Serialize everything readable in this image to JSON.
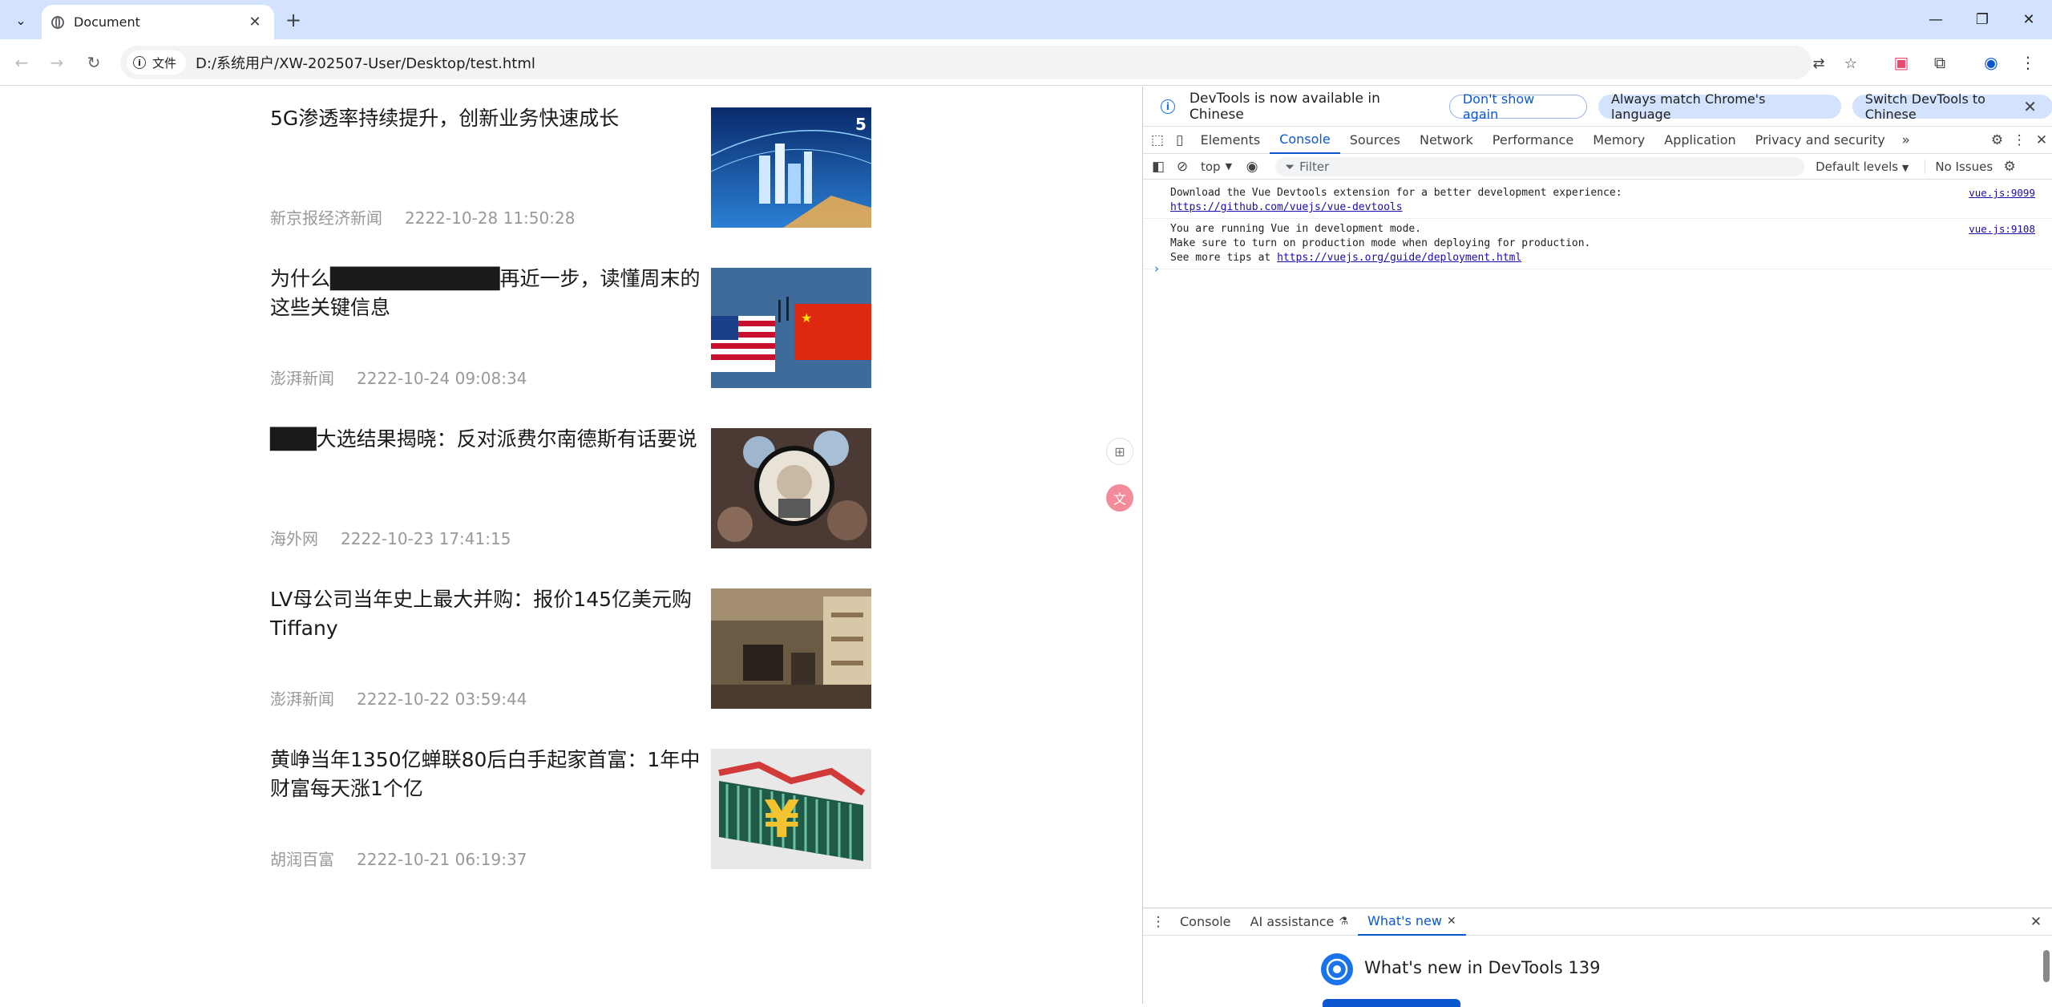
{
  "browser": {
    "tab_title": "Document",
    "chip_label": "文件",
    "url": "D:/系统用户/XW-202507-User/Desktop/test.html"
  },
  "news": [
    {
      "title": "5G渗透率持续提升，创新业务快速成长",
      "source": "新京报经济新闻",
      "date": "2222-10-28 11:50:28"
    },
    {
      "title": "为什么███████████再近一步，读懂周末的这些关键信息",
      "source": "澎湃新闻",
      "date": "2222-10-24 09:08:34"
    },
    {
      "title": "███大选结果揭晓：反对派费尔南德斯有话要说",
      "source": "海外网",
      "date": "2222-10-23 17:41:15"
    },
    {
      "title": "LV母公司当年史上最大并购：报价145亿美元购Tiffany",
      "source": "澎湃新闻",
      "date": "2222-10-22 03:59:44"
    },
    {
      "title": "黄峥当年1350亿蝉联80后白手起家首富：1年中财富每天涨1个亿",
      "source": "胡润百富",
      "date": "2222-10-21 06:19:37"
    }
  ],
  "devtools": {
    "infobar_message": "DevTools is now available in Chinese",
    "btn_dont_show": "Don't show again",
    "btn_match": "Always match Chrome's language",
    "btn_switch": "Switch DevTools to Chinese",
    "tabs": [
      "Elements",
      "Console",
      "Sources",
      "Network",
      "Performance",
      "Memory",
      "Application",
      "Privacy and security"
    ],
    "context": "top",
    "filter_placeholder": "Filter",
    "levels": "Default levels",
    "issues": "No Issues",
    "logs": [
      {
        "line1": "Download the Vue Devtools extension for a better development experience:",
        "link": "https://github.com/vuejs/vue-devtools",
        "src": "vue.js:9099"
      },
      {
        "line1": "You are running Vue in development mode.",
        "line2": "Make sure to turn on production mode when deploying for production.",
        "line3_prefix": "See more tips at ",
        "link": "https://vuejs.org/guide/deployment.html",
        "src": "vue.js:9108"
      }
    ],
    "drawer_tabs": [
      "Console",
      "AI assistance",
      "What's new"
    ],
    "whats_new_title": "What's new in DevTools 139"
  }
}
